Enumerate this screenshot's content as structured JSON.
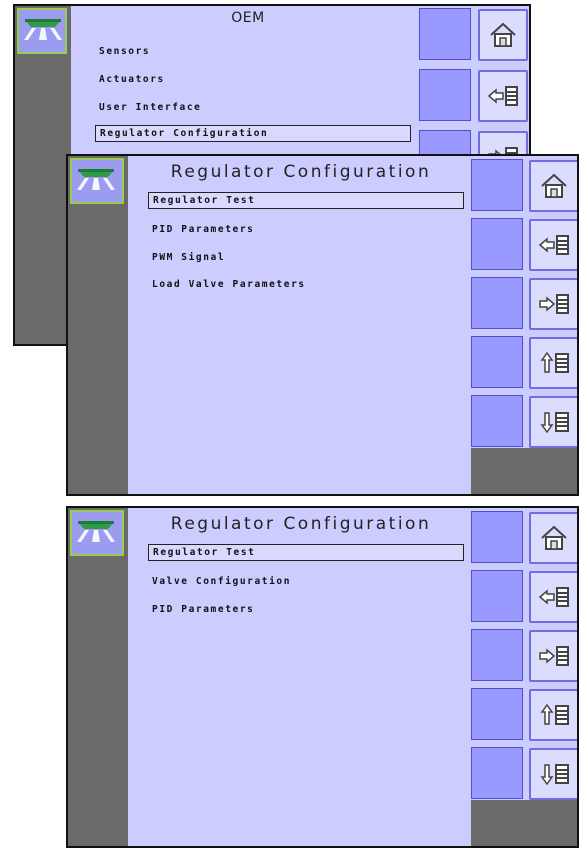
{
  "screens": {
    "oem": {
      "title": "OEM",
      "items": [
        "Sensors",
        "Actuators",
        "User Interface",
        "Regulator Configuration"
      ],
      "selected_index": 3
    },
    "regulator_a": {
      "title": "Regulator Configuration",
      "items": [
        "Regulator Test",
        "PID Parameters",
        "PWM Signal",
        "Load Valve Parameters"
      ],
      "selected_index": 0
    },
    "regulator_b": {
      "title": "Regulator Configuration",
      "items": [
        "Regulator Test",
        "Valve Configuration",
        "PID Parameters"
      ],
      "selected_index": 0
    }
  },
  "icons": {
    "home": "house-icon",
    "back": "arrow-left-list-icon",
    "forward": "arrow-right-list-icon",
    "up": "arrow-up-list-icon",
    "down": "arrow-down-list-icon",
    "app": "sprayer-icon"
  },
  "colors": {
    "screen_bg": "#CCCCFF",
    "sidebar": "#6a6a6a",
    "button_fill": "#9999FF",
    "button_border": "#6E6EE0",
    "home_tile_border": "#99CC55",
    "sprayer_green": "#2E9A4A"
  }
}
